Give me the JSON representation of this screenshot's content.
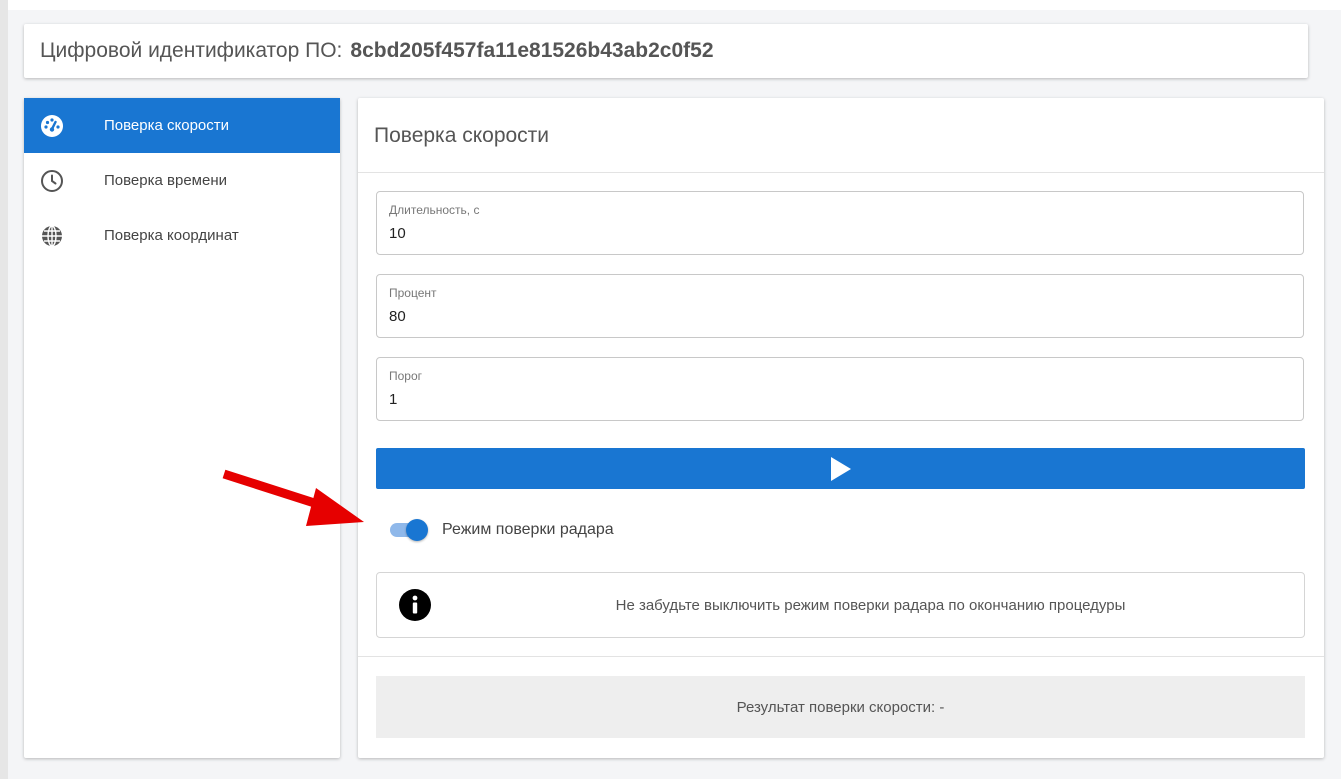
{
  "header": {
    "label": "Цифровой идентификатор ПО:",
    "hash": "8cbd205f457fa11e81526b43ab2c0f52"
  },
  "sidebar": {
    "items": [
      {
        "label": "Поверка скорости",
        "icon": "speedometer-icon",
        "active": true
      },
      {
        "label": "Поверка времени",
        "icon": "clock-icon",
        "active": false
      },
      {
        "label": "Поверка координат",
        "icon": "globe-icon",
        "active": false
      }
    ]
  },
  "main": {
    "title": "Поверка скорости",
    "fields": {
      "duration": {
        "label": "Длительность, с",
        "value": "10"
      },
      "percent": {
        "label": "Процент",
        "value": "80"
      },
      "threshold": {
        "label": "Порог",
        "value": "1"
      }
    },
    "play_icon": "play-icon",
    "toggle": {
      "label": "Режим поверки радара",
      "checked": true
    },
    "info": {
      "icon": "info-icon",
      "text": "Не забудьте выключить режим поверки радара по окончанию процедуры"
    },
    "result": "Результат поверки скорости: -"
  },
  "colors": {
    "accent": "#1976d2",
    "toggle_track": "#8fb8ea",
    "annotation_arrow": "#e60000",
    "background": "#f4f5f7"
  }
}
